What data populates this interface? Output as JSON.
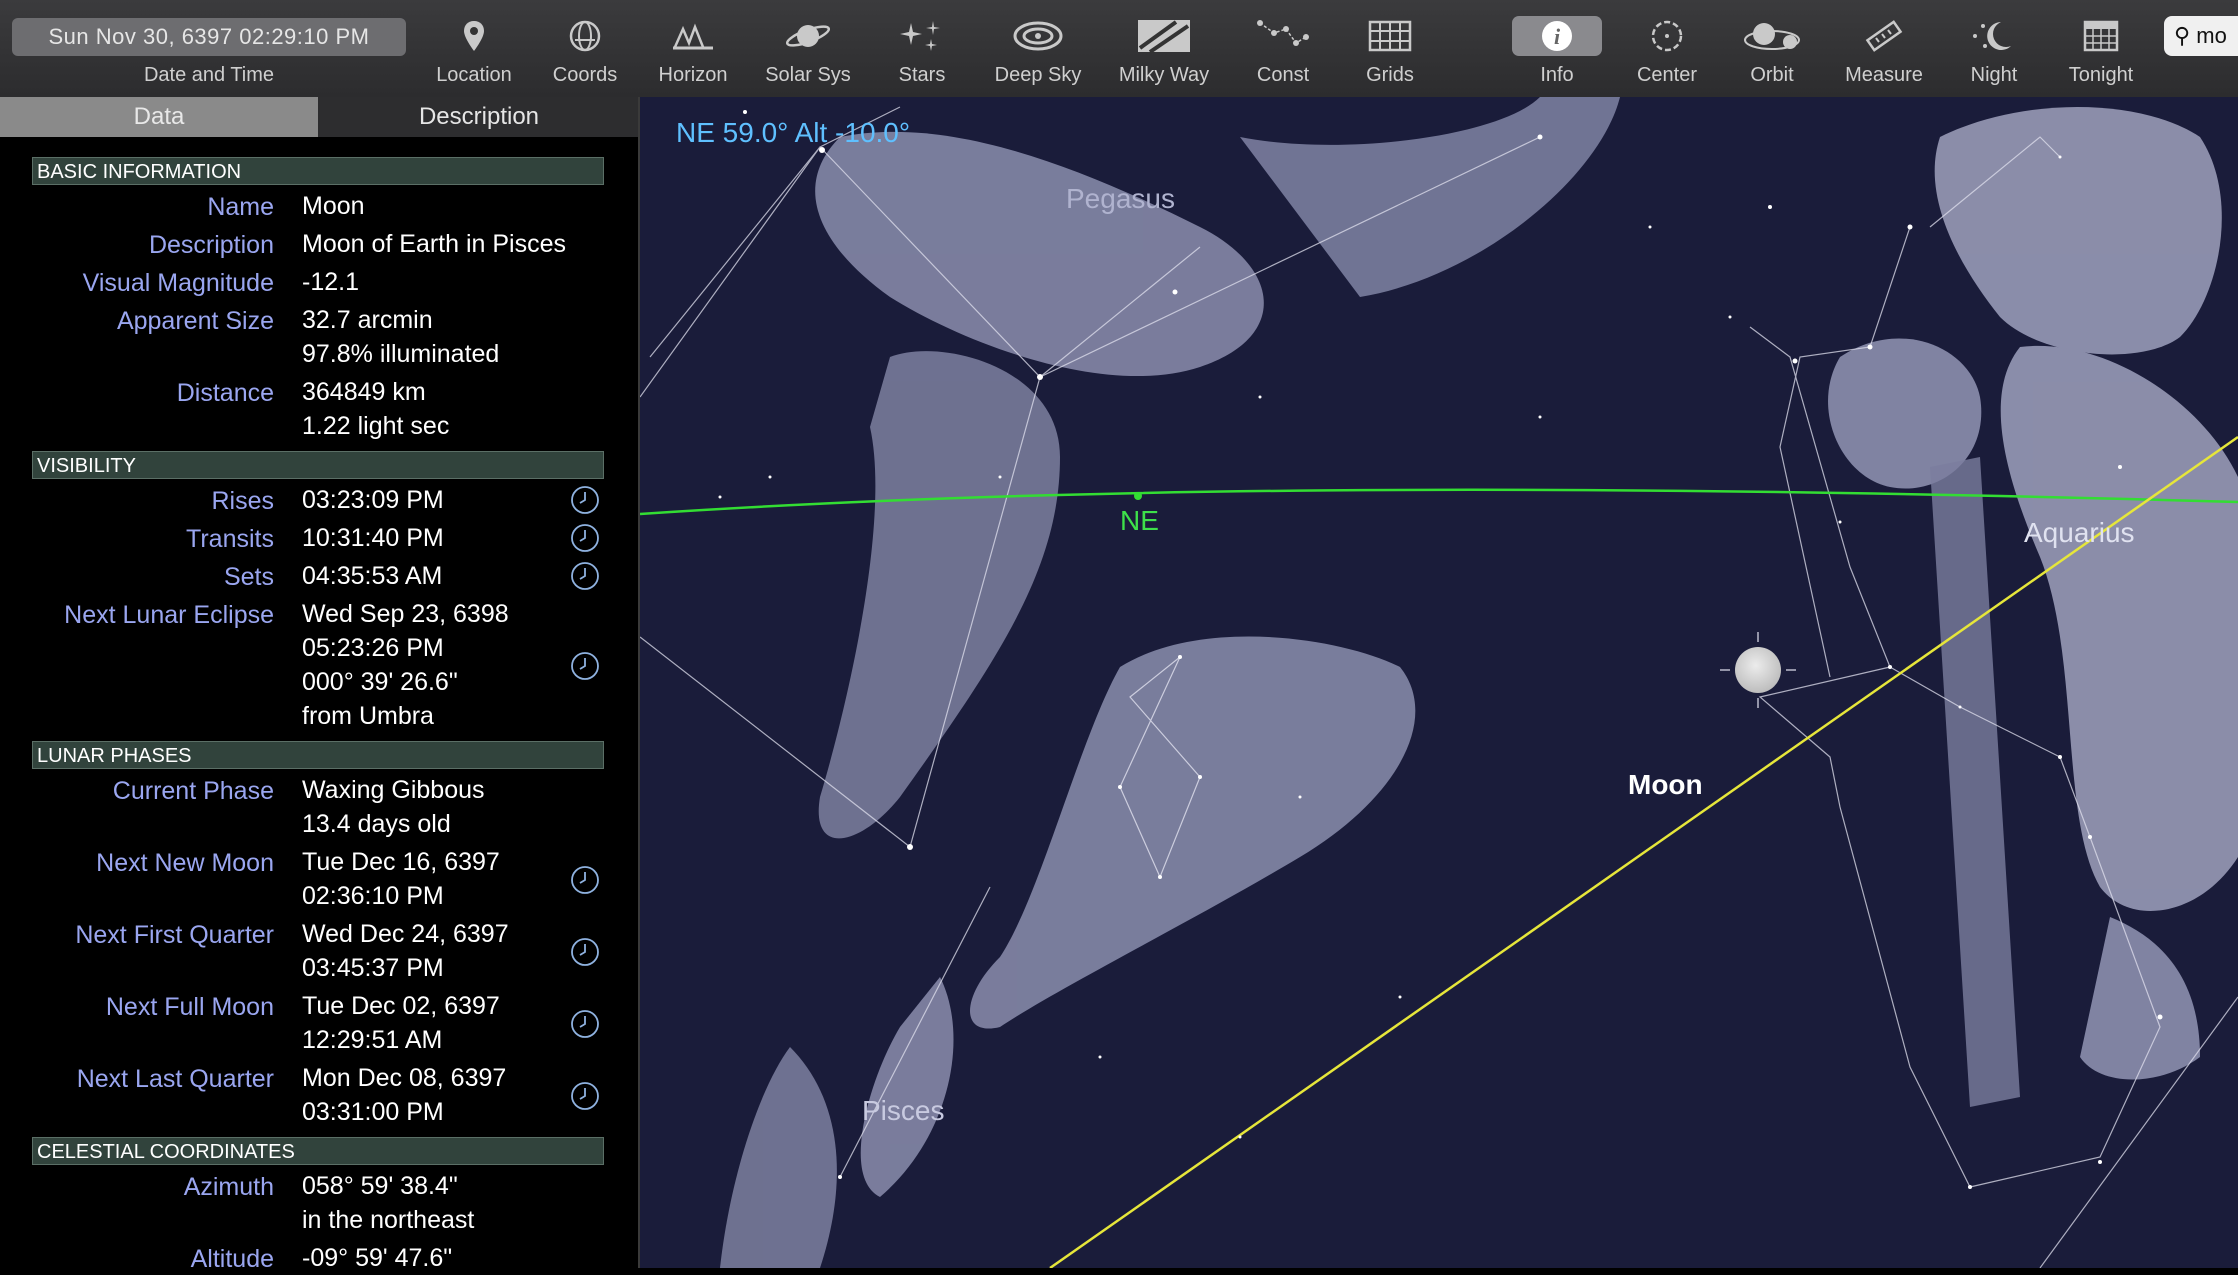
{
  "toolbar": {
    "datetime": "Sun Nov 30, 6397  02:29:10 PM",
    "datetime_label": "Date and Time",
    "tools": [
      {
        "label": "Location",
        "icon": "location-pin-icon"
      },
      {
        "label": "Coords",
        "icon": "coords-icon"
      },
      {
        "label": "Horizon",
        "icon": "horizon-icon"
      },
      {
        "label": "Solar Sys",
        "icon": "saturn-icon"
      },
      {
        "label": "Stars",
        "icon": "stars-icon"
      },
      {
        "label": "Deep Sky",
        "icon": "galaxy-icon"
      },
      {
        "label": "Milky Way",
        "icon": "milky-way-icon"
      },
      {
        "label": "Const",
        "icon": "constellation-icon"
      },
      {
        "label": "Grids",
        "icon": "grid-icon"
      },
      {
        "label": "Info",
        "icon": "info-icon"
      },
      {
        "label": "Center",
        "icon": "center-icon"
      },
      {
        "label": "Orbit",
        "icon": "orbit-icon"
      },
      {
        "label": "Measure",
        "icon": "ruler-icon"
      },
      {
        "label": "Night",
        "icon": "moon-icon"
      },
      {
        "label": "Tonight",
        "icon": "calendar-icon"
      }
    ],
    "search_value": "mo"
  },
  "panel": {
    "tabs": [
      "Data",
      "Description"
    ],
    "sections": {
      "basic": "BASIC INFORMATION",
      "visibility": "VISIBILITY",
      "phases": "LUNAR PHASES",
      "coords": "CELESTIAL COORDINATES"
    },
    "basic": {
      "name_label": "Name",
      "name": "Moon",
      "desc_label": "Description",
      "desc": "Moon of Earth in Pisces",
      "mag_label": "Visual Magnitude",
      "mag": "-12.1",
      "size_label": "Apparent Size",
      "size1": "32.7 arcmin",
      "size2": "97.8% illuminated",
      "dist_label": "Distance",
      "dist1": "364849 km",
      "dist2": "1.22 light sec"
    },
    "visibility": {
      "rises_label": "Rises",
      "rises": "03:23:09 PM",
      "transits_label": "Transits",
      "transits": "10:31:40 PM",
      "sets_label": "Sets",
      "sets": "04:35:53 AM",
      "eclipse_label": "Next Lunar Eclipse",
      "eclipse1": "Wed Sep 23, 6398",
      "eclipse2": "05:23:26 PM",
      "eclipse3": "000° 39' 26.6\"",
      "eclipse4": "from Umbra"
    },
    "phases": {
      "current_label": "Current Phase",
      "current1": "Waxing Gibbous",
      "current2": "13.4 days old",
      "new_label": "Next New Moon",
      "new1": "Tue Dec 16, 6397",
      "new2": "02:36:10 PM",
      "first_label": "Next First Quarter",
      "first1": "Wed Dec 24, 6397",
      "first2": "03:45:37 PM",
      "full_label": "Next Full Moon",
      "full1": "Tue Dec 02, 6397",
      "full2": "12:29:51 AM",
      "last_label": "Next Last Quarter",
      "last1": "Mon Dec 08, 6397",
      "last2": "03:31:00 PM"
    },
    "coords": {
      "az_label": "Azimuth",
      "az1": "058° 59' 38.4\"",
      "az2": "in the northeast",
      "alt_label": "Altitude",
      "alt1": "-09° 59' 47.6\""
    }
  },
  "sky": {
    "coord_readout": "NE 59.0° Alt -10.0°",
    "direction": "NE",
    "constellations": [
      "Pegasus",
      "Aquarius",
      "Pisces"
    ],
    "object_label": "Moon",
    "colors": {
      "horizon": "#33dd33",
      "ecliptic": "#e6e63a",
      "readout": "#5fc0ff",
      "sky": "#1a1c3a"
    }
  }
}
